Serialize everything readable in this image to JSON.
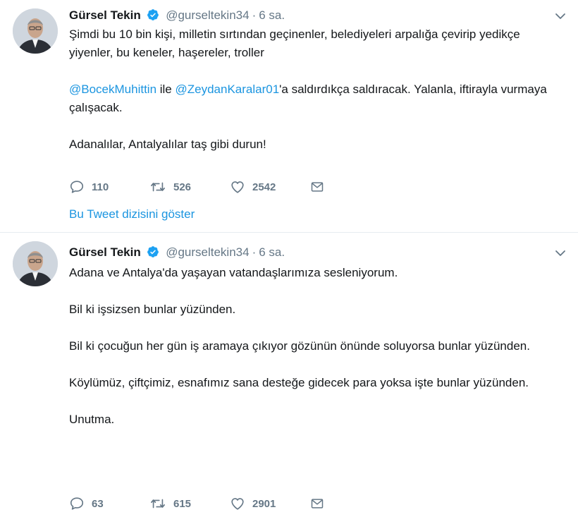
{
  "tweets": [
    {
      "author_name": "Gürsel Tekin",
      "handle": "@gurseltekin34",
      "separator": "·",
      "time": "6 sa.",
      "paragraphs": [
        {
          "segments": [
            {
              "text": "Şimdi bu 10 bin kişi, milletin sırtından geçinenler, belediyeleri arpalığa çevirip yedikçe yiyenler, bu keneler, haşereler, troller",
              "mention": false
            }
          ]
        },
        {
          "segments": [
            {
              "text": "@BocekMuhittin",
              "mention": true
            },
            {
              "text": " ile ",
              "mention": false
            },
            {
              "text": "@ZeydanKaralar01",
              "mention": true
            },
            {
              "text": "'a saldırdıkça saldıracak. Yalanla, iftirayla vurmaya çalışacak.",
              "mention": false
            }
          ]
        },
        {
          "segments": [
            {
              "text": "Adanalılar, Antalyalılar taş gibi durun!",
              "mention": false
            }
          ]
        }
      ],
      "reply_count": "110",
      "retweet_count": "526",
      "like_count": "2542",
      "thread_link": "Bu Tweet dizisini göster"
    },
    {
      "author_name": "Gürsel Tekin",
      "handle": "@gurseltekin34",
      "separator": "·",
      "time": "6 sa.",
      "paragraphs": [
        {
          "segments": [
            {
              "text": "Adana ve Antalya'da yaşayan vatandaşlarımıza sesleniyorum.",
              "mention": false
            }
          ]
        },
        {
          "segments": [
            {
              "text": "Bil ki işsizsen bunlar yüzünden.",
              "mention": false
            }
          ]
        },
        {
          "segments": [
            {
              "text": "Bil ki çocuğun her gün iş aramaya çıkıyor gözünün önünde soluyorsa bunlar yüzünden.",
              "mention": false
            }
          ]
        },
        {
          "segments": [
            {
              "text": "Köylümüz, çiftçimiz, esnafımız sana desteğe gidecek para yoksa işte bunlar yüzünden.",
              "mention": false
            }
          ]
        },
        {
          "segments": [
            {
              "text": "Unutma.",
              "mention": false
            }
          ]
        }
      ],
      "reply_count": "63",
      "retweet_count": "615",
      "like_count": "2901"
    }
  ],
  "colors": {
    "text": "#14171a",
    "secondary": "#657786",
    "link": "#1b95e0",
    "verified": "#1da1f2",
    "divider": "#e6ecf0"
  },
  "icons": [
    "verified-badge-icon",
    "chevron-down-icon",
    "reply-icon",
    "retweet-icon",
    "like-heart-icon",
    "direct-message-icon"
  ]
}
